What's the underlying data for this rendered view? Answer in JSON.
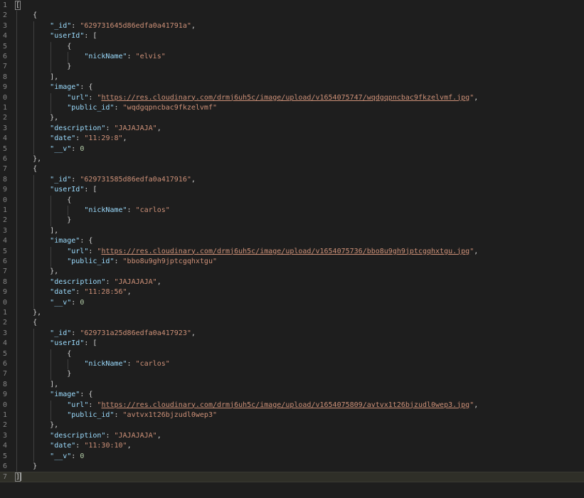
{
  "editor": {
    "language": "json",
    "current_line": 47,
    "lines": [
      [
        {
          "t": "p",
          "v": "["
        }
      ],
      [
        {
          "t": "p",
          "v": "    {"
        }
      ],
      [
        {
          "t": "w",
          "v": "        "
        },
        {
          "t": "k",
          "v": "\"_id\""
        },
        {
          "t": "p",
          "v": ": "
        },
        {
          "t": "s",
          "v": "\"629731645d86edfa0a41791a\""
        },
        {
          "t": "p",
          "v": ","
        }
      ],
      [
        {
          "t": "w",
          "v": "        "
        },
        {
          "t": "k",
          "v": "\"userId\""
        },
        {
          "t": "p",
          "v": ": ["
        }
      ],
      [
        {
          "t": "p",
          "v": "            {"
        }
      ],
      [
        {
          "t": "w",
          "v": "                "
        },
        {
          "t": "k",
          "v": "\"nickName\""
        },
        {
          "t": "p",
          "v": ": "
        },
        {
          "t": "s",
          "v": "\"elvis\""
        }
      ],
      [
        {
          "t": "p",
          "v": "            }"
        }
      ],
      [
        {
          "t": "p",
          "v": "        ],"
        }
      ],
      [
        {
          "t": "w",
          "v": "        "
        },
        {
          "t": "k",
          "v": "\"image\""
        },
        {
          "t": "p",
          "v": ": {"
        }
      ],
      [
        {
          "t": "w",
          "v": "            "
        },
        {
          "t": "k",
          "v": "\"url\""
        },
        {
          "t": "p",
          "v": ": "
        },
        {
          "t": "s",
          "v": "\""
        },
        {
          "t": "l",
          "v": "https://res.cloudinary.com/drmj6uh5c/image/upload/v1654075747/wqdgqpncbac9fkzelvmf.jpg"
        },
        {
          "t": "s",
          "v": "\""
        },
        {
          "t": "p",
          "v": ","
        }
      ],
      [
        {
          "t": "w",
          "v": "            "
        },
        {
          "t": "k",
          "v": "\"public_id\""
        },
        {
          "t": "p",
          "v": ": "
        },
        {
          "t": "s",
          "v": "\"wqdgqpncbac9fkzelvmf\""
        }
      ],
      [
        {
          "t": "p",
          "v": "        },"
        }
      ],
      [
        {
          "t": "w",
          "v": "        "
        },
        {
          "t": "k",
          "v": "\"description\""
        },
        {
          "t": "p",
          "v": ": "
        },
        {
          "t": "s",
          "v": "\"JAJAJAJA\""
        },
        {
          "t": "p",
          "v": ","
        }
      ],
      [
        {
          "t": "w",
          "v": "        "
        },
        {
          "t": "k",
          "v": "\"date\""
        },
        {
          "t": "p",
          "v": ": "
        },
        {
          "t": "s",
          "v": "\"11:29:8\""
        },
        {
          "t": "p",
          "v": ","
        }
      ],
      [
        {
          "t": "w",
          "v": "        "
        },
        {
          "t": "k",
          "v": "\"__v\""
        },
        {
          "t": "p",
          "v": ": "
        },
        {
          "t": "n",
          "v": "0"
        }
      ],
      [
        {
          "t": "p",
          "v": "    },"
        }
      ],
      [
        {
          "t": "p",
          "v": "    {"
        }
      ],
      [
        {
          "t": "w",
          "v": "        "
        },
        {
          "t": "k",
          "v": "\"_id\""
        },
        {
          "t": "p",
          "v": ": "
        },
        {
          "t": "s",
          "v": "\"629731585d86edfa0a417916\""
        },
        {
          "t": "p",
          "v": ","
        }
      ],
      [
        {
          "t": "w",
          "v": "        "
        },
        {
          "t": "k",
          "v": "\"userId\""
        },
        {
          "t": "p",
          "v": ": ["
        }
      ],
      [
        {
          "t": "p",
          "v": "            {"
        }
      ],
      [
        {
          "t": "w",
          "v": "                "
        },
        {
          "t": "k",
          "v": "\"nickName\""
        },
        {
          "t": "p",
          "v": ": "
        },
        {
          "t": "s",
          "v": "\"carlos\""
        }
      ],
      [
        {
          "t": "p",
          "v": "            }"
        }
      ],
      [
        {
          "t": "p",
          "v": "        ],"
        }
      ],
      [
        {
          "t": "w",
          "v": "        "
        },
        {
          "t": "k",
          "v": "\"image\""
        },
        {
          "t": "p",
          "v": ": {"
        }
      ],
      [
        {
          "t": "w",
          "v": "            "
        },
        {
          "t": "k",
          "v": "\"url\""
        },
        {
          "t": "p",
          "v": ": "
        },
        {
          "t": "s",
          "v": "\""
        },
        {
          "t": "l",
          "v": "https://res.cloudinary.com/drmj6uh5c/image/upload/v1654075736/bbo8u9gh9jptcgqhxtgu.jpg"
        },
        {
          "t": "s",
          "v": "\""
        },
        {
          "t": "p",
          "v": ","
        }
      ],
      [
        {
          "t": "w",
          "v": "            "
        },
        {
          "t": "k",
          "v": "\"public_id\""
        },
        {
          "t": "p",
          "v": ": "
        },
        {
          "t": "s",
          "v": "\"bbo8u9gh9jptcgqhxtgu\""
        }
      ],
      [
        {
          "t": "p",
          "v": "        },"
        }
      ],
      [
        {
          "t": "w",
          "v": "        "
        },
        {
          "t": "k",
          "v": "\"description\""
        },
        {
          "t": "p",
          "v": ": "
        },
        {
          "t": "s",
          "v": "\"JAJAJAJA\""
        },
        {
          "t": "p",
          "v": ","
        }
      ],
      [
        {
          "t": "w",
          "v": "        "
        },
        {
          "t": "k",
          "v": "\"date\""
        },
        {
          "t": "p",
          "v": ": "
        },
        {
          "t": "s",
          "v": "\"11:28:56\""
        },
        {
          "t": "p",
          "v": ","
        }
      ],
      [
        {
          "t": "w",
          "v": "        "
        },
        {
          "t": "k",
          "v": "\"__v\""
        },
        {
          "t": "p",
          "v": ": "
        },
        {
          "t": "n",
          "v": "0"
        }
      ],
      [
        {
          "t": "p",
          "v": "    },"
        }
      ],
      [
        {
          "t": "p",
          "v": "    {"
        }
      ],
      [
        {
          "t": "w",
          "v": "        "
        },
        {
          "t": "k",
          "v": "\"_id\""
        },
        {
          "t": "p",
          "v": ": "
        },
        {
          "t": "s",
          "v": "\"629731a25d86edfa0a417923\""
        },
        {
          "t": "p",
          "v": ","
        }
      ],
      [
        {
          "t": "w",
          "v": "        "
        },
        {
          "t": "k",
          "v": "\"userId\""
        },
        {
          "t": "p",
          "v": ": ["
        }
      ],
      [
        {
          "t": "p",
          "v": "            {"
        }
      ],
      [
        {
          "t": "w",
          "v": "                "
        },
        {
          "t": "k",
          "v": "\"nickName\""
        },
        {
          "t": "p",
          "v": ": "
        },
        {
          "t": "s",
          "v": "\"carlos\""
        }
      ],
      [
        {
          "t": "p",
          "v": "            }"
        }
      ],
      [
        {
          "t": "p",
          "v": "        ],"
        }
      ],
      [
        {
          "t": "w",
          "v": "        "
        },
        {
          "t": "k",
          "v": "\"image\""
        },
        {
          "t": "p",
          "v": ": {"
        }
      ],
      [
        {
          "t": "w",
          "v": "            "
        },
        {
          "t": "k",
          "v": "\"url\""
        },
        {
          "t": "p",
          "v": ": "
        },
        {
          "t": "s",
          "v": "\""
        },
        {
          "t": "l",
          "v": "https://res.cloudinary.com/drmj6uh5c/image/upload/v1654075809/avtvx1t26bjzudl0wep3.jpg"
        },
        {
          "t": "s",
          "v": "\""
        },
        {
          "t": "p",
          "v": ","
        }
      ],
      [
        {
          "t": "w",
          "v": "            "
        },
        {
          "t": "k",
          "v": "\"public_id\""
        },
        {
          "t": "p",
          "v": ": "
        },
        {
          "t": "s",
          "v": "\"avtvx1t26bjzudl0wep3\""
        }
      ],
      [
        {
          "t": "p",
          "v": "        },"
        }
      ],
      [
        {
          "t": "w",
          "v": "        "
        },
        {
          "t": "k",
          "v": "\"description\""
        },
        {
          "t": "p",
          "v": ": "
        },
        {
          "t": "s",
          "v": "\"JAJAJAJA\""
        },
        {
          "t": "p",
          "v": ","
        }
      ],
      [
        {
          "t": "w",
          "v": "        "
        },
        {
          "t": "k",
          "v": "\"date\""
        },
        {
          "t": "p",
          "v": ": "
        },
        {
          "t": "s",
          "v": "\"11:30:10\""
        },
        {
          "t": "p",
          "v": ","
        }
      ],
      [
        {
          "t": "w",
          "v": "        "
        },
        {
          "t": "k",
          "v": "\"__v\""
        },
        {
          "t": "p",
          "v": ": "
        },
        {
          "t": "n",
          "v": "0"
        }
      ],
      [
        {
          "t": "p",
          "v": "    }"
        }
      ],
      [
        {
          "t": "p",
          "v": "]"
        }
      ]
    ],
    "line_numbers": [
      "1",
      "2",
      "3",
      "4",
      "5",
      "6",
      "7",
      "8",
      "9",
      "0",
      "1",
      "2",
      "3",
      "4",
      "5",
      "6",
      "7",
      "8",
      "9",
      "0",
      "1",
      "2",
      "3",
      "4",
      "5",
      "6",
      "7",
      "8",
      "9",
      "0",
      "1",
      "2",
      "3",
      "4",
      "5",
      "6",
      "7",
      "8",
      "9",
      "0",
      "1",
      "2",
      "3",
      "4",
      "5",
      "6",
      "7"
    ]
  },
  "colors": {
    "background": "#1e1e1e",
    "key": "#9cdcfe",
    "string": "#ce9178",
    "number": "#b5cea8",
    "punctuation": "#d4d4d4",
    "line_number": "#858585",
    "current_line": "#2f2f28"
  }
}
